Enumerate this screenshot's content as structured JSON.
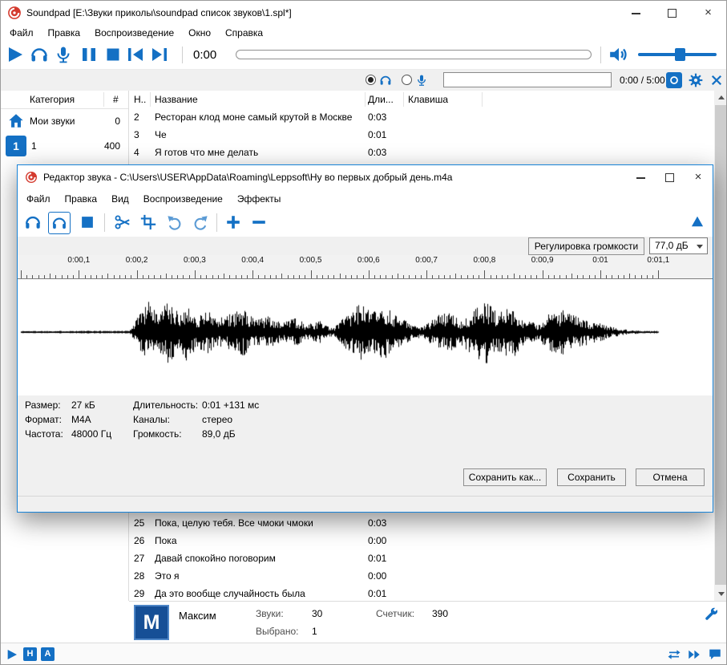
{
  "main_window": {
    "title": "Soundpad [E:\\Звуки приколы\\soundpad список звуков\\1.spl*]",
    "menu": [
      "Файл",
      "Правка",
      "Воспроизведение",
      "Окно",
      "Справка"
    ],
    "toolbar": {
      "elapsed_time": "0:00"
    },
    "sub_toolbar": {
      "search_value": "",
      "time_total": "0:00 / 5:00"
    },
    "category_panel": {
      "name_header": "Категория",
      "count_header": "#",
      "items": [
        {
          "label": "Мои звуки",
          "count": "0"
        },
        {
          "label": "1",
          "count": "400",
          "icon_text": "1"
        }
      ]
    },
    "sound_list": {
      "col_num": "Н..",
      "col_name": "Название",
      "col_duration": "Дли...",
      "col_key": "Клавиша",
      "rows_above": [
        {
          "num": "2",
          "name": "Ресторан клод моне самый крутой в Москве",
          "dur": "0:03"
        },
        {
          "num": "3",
          "name": "Че",
          "dur": "0:01"
        },
        {
          "num": "4",
          "name": "Я готов что мне делать",
          "dur": "0:03"
        }
      ],
      "rows_below": [
        {
          "num": "25",
          "name": "Пока, целую тебя. Все чмоки чмоки",
          "dur": "0:03"
        },
        {
          "num": "26",
          "name": "Пока",
          "dur": "0:00"
        },
        {
          "num": "27",
          "name": "Давай спокойно поговорим",
          "dur": "0:01"
        },
        {
          "num": "28",
          "name": "Это я",
          "dur": "0:00"
        },
        {
          "num": "29",
          "name": "Да это вообще случайность была",
          "dur": "0:01"
        }
      ]
    },
    "user_panel": {
      "avatar_letter": "M",
      "name": "Максим",
      "sounds_label": "Звуки:",
      "sounds_value": "30",
      "selected_label": "Выбрано:",
      "selected_value": "1",
      "counter_label": "Счетчик:",
      "counter_value": "390"
    },
    "status_bar": {
      "badge_h": "H",
      "badge_a": "A"
    }
  },
  "editor": {
    "title": "Редактор звука - C:\\Users\\USER\\AppData\\Roaming\\Leppsoft\\Ну во первых добрый день.m4a",
    "menu": [
      "Файл",
      "Правка",
      "Вид",
      "Воспроизведение",
      "Эффекты"
    ],
    "volume_button_label": "Регулировка громкости",
    "volume_value": "77,0 дБ",
    "ruler_labels": [
      "0:00,1",
      "0:00,2",
      "0:00,3",
      "0:00,4",
      "0:00,5",
      "0:00,6",
      "0:00,7",
      "0:00,8",
      "0:00,9",
      "0:01",
      "0:01,1"
    ],
    "info": {
      "size_label": "Размер:",
      "size_value": "27 кБ",
      "format_label": "Формат:",
      "format_value": "M4A",
      "rate_label": "Частота:",
      "rate_value": "48000 Гц",
      "duration_label": "Длительность:",
      "duration_value": "0:01 +131 мс",
      "channels_label": "Каналы:",
      "channels_value": "стерео",
      "volume_label": "Громкость:",
      "volume_value": "89,0 дБ"
    },
    "buttons": {
      "save_as": "Сохранить как...",
      "save": "Сохранить",
      "cancel": "Отмена"
    },
    "waveform_envelope": [
      [
        0,
        0.02
      ],
      [
        0.17,
        0.03
      ],
      [
        0.185,
        0.6
      ],
      [
        0.2,
        0.95
      ],
      [
        0.215,
        0.55
      ],
      [
        0.23,
        1.0
      ],
      [
        0.245,
        0.65
      ],
      [
        0.26,
        0.9
      ],
      [
        0.275,
        0.5
      ],
      [
        0.29,
        0.7
      ],
      [
        0.31,
        0.45
      ],
      [
        0.33,
        0.6
      ],
      [
        0.35,
        0.75
      ],
      [
        0.37,
        0.4
      ],
      [
        0.39,
        0.5
      ],
      [
        0.41,
        0.3
      ],
      [
        0.43,
        0.45
      ],
      [
        0.45,
        0.25
      ],
      [
        0.47,
        0.35
      ],
      [
        0.49,
        0.12
      ],
      [
        0.51,
        0.55
      ],
      [
        0.53,
        0.95
      ],
      [
        0.55,
        0.6
      ],
      [
        0.57,
        0.85
      ],
      [
        0.59,
        0.5
      ],
      [
        0.61,
        0.3
      ],
      [
        0.63,
        0.15
      ],
      [
        0.65,
        0.5
      ],
      [
        0.67,
        0.65
      ],
      [
        0.69,
        0.4
      ],
      [
        0.71,
        0.75
      ],
      [
        0.73,
        1.0
      ],
      [
        0.75,
        0.6
      ],
      [
        0.77,
        0.85
      ],
      [
        0.79,
        0.4
      ],
      [
        0.81,
        0.25
      ],
      [
        0.83,
        0.6
      ],
      [
        0.85,
        0.7
      ],
      [
        0.87,
        0.5
      ],
      [
        0.89,
        0.4
      ],
      [
        0.91,
        0.28
      ],
      [
        0.93,
        0.15
      ],
      [
        0.95,
        0.08
      ],
      [
        0.97,
        0.05
      ],
      [
        1,
        0.03
      ]
    ]
  }
}
